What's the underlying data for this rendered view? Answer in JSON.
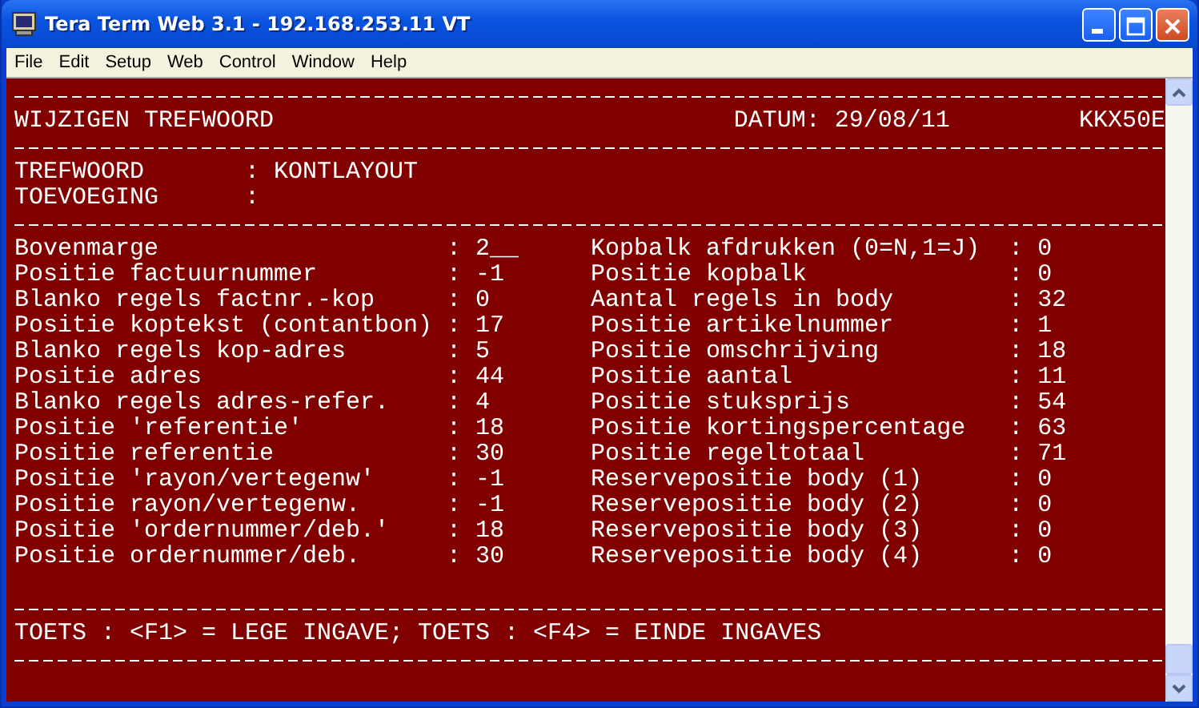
{
  "window": {
    "title": "Tera Term Web 3.1 - 192.168.253.11 VT"
  },
  "menu": [
    "File",
    "Edit",
    "Setup",
    "Web",
    "Control",
    "Window",
    "Help"
  ],
  "header": {
    "title": "WIJZIGEN TREFWOORD",
    "date_label": "DATUM:",
    "date": "29/08/11",
    "code": "KKX50E"
  },
  "fields": [
    {
      "label": "TREFWOORD",
      "colon": ":",
      "value": "KONTLAYOUT"
    },
    {
      "label": "TOEVOEGING",
      "colon": ":"
    }
  ],
  "params": [
    {
      "left": {
        "label": "Bovenmarge",
        "value": ": 2__"
      },
      "right": {
        "label": "Kopbalk afdrukken (0=N,1=J)",
        "value": ": 0"
      }
    },
    {
      "left": {
        "label": "Positie factuurnummer",
        "value": ": -1"
      },
      "right": {
        "label": "Positie kopbalk",
        "value": ": 0"
      }
    },
    {
      "left": {
        "label": "Blanko regels factnr.-kop",
        "value": ": 0"
      },
      "right": {
        "label": "Aantal regels in body",
        "value": ": 32"
      }
    },
    {
      "left": {
        "label": "Positie koptekst (contantbon)",
        "value": ": 17"
      },
      "right": {
        "label": "Positie artikelnummer",
        "value": ": 1"
      }
    },
    {
      "left": {
        "label": "Blanko regels kop-adres",
        "value": ": 5"
      },
      "right": {
        "label": "Positie omschrijving",
        "value": ": 18"
      }
    },
    {
      "left": {
        "label": "Positie adres",
        "value": ": 44"
      },
      "right": {
        "label": "Positie aantal",
        "value": ": 11"
      }
    },
    {
      "left": {
        "label": "Blanko regels adres-refer.",
        "value": ": 4"
      },
      "right": {
        "label": "Positie stuksprijs",
        "value": ": 54"
      }
    },
    {
      "left": {
        "label": "Positie 'referentie'",
        "value": ": 18"
      },
      "right": {
        "label": "Positie kortingspercentage",
        "value": ": 63"
      }
    },
    {
      "left": {
        "label": "Positie referentie",
        "value": ": 30"
      },
      "right": {
        "label": "Positie regeltotaal",
        "value": ": 71"
      }
    },
    {
      "left": {
        "label": "Positie 'rayon/vertegenw'",
        "value": ": -1"
      },
      "right": {
        "label": "Reservepositie body (1)",
        "value": ": 0"
      }
    },
    {
      "left": {
        "label": "Positie rayon/vertegenw.",
        "value": ": -1"
      },
      "right": {
        "label": "Reservepositie body (2)",
        "value": ": 0"
      }
    },
    {
      "left": {
        "label": "Positie 'ordernummer/deb.'",
        "value": ": 18"
      },
      "right": {
        "label": "Reservepositie body (3)",
        "value": ": 0"
      }
    },
    {
      "left": {
        "label": "Positie ordernummer/deb.",
        "value": ": 30"
      },
      "right": {
        "label": "Reservepositie body (4)",
        "value": ": 0"
      }
    }
  ],
  "footer": "TOETS : <F1> = LEGE INGAVE; TOETS : <F4> = EINDE INGAVES"
}
